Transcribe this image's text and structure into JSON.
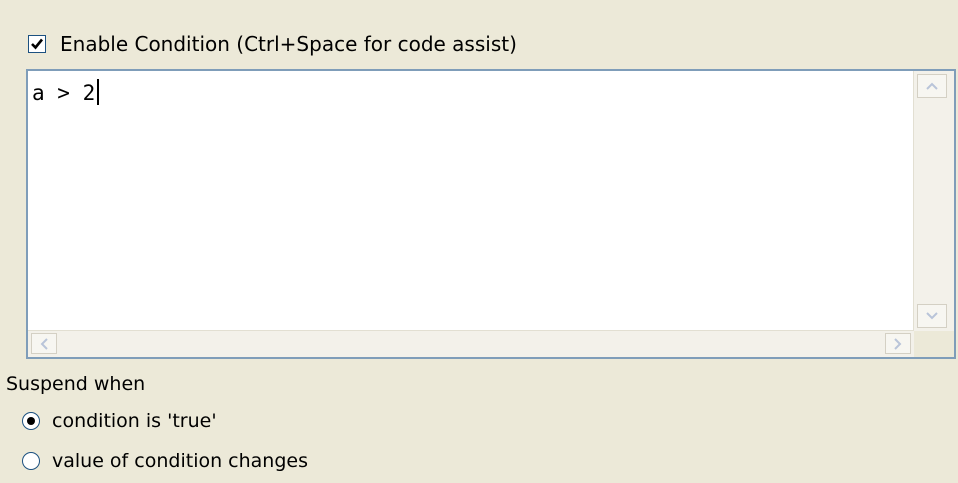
{
  "enable_condition": {
    "checked": true,
    "label": "Enable Condition (Ctrl+Space for code assist)"
  },
  "editor": {
    "content": "a > 2"
  },
  "suspend": {
    "label": "Suspend when",
    "options": [
      {
        "label": "condition is 'true'",
        "selected": true
      },
      {
        "label": "value of condition changes",
        "selected": false
      }
    ]
  }
}
